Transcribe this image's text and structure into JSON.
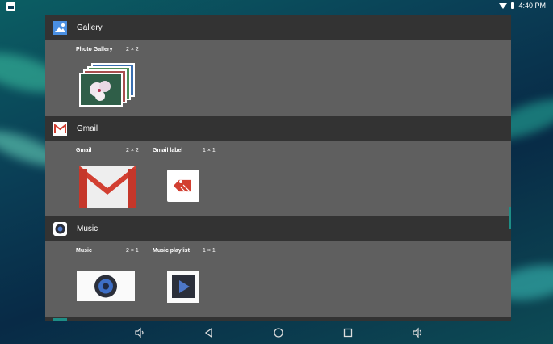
{
  "status_bar": {
    "time": "4:40 PM"
  },
  "sections": [
    {
      "title": "Gallery",
      "icon": "gallery-app-icon",
      "widgets": [
        {
          "name": "Photo Gallery",
          "size": "2 × 2"
        }
      ]
    },
    {
      "title": "Gmail",
      "icon": "gmail-app-icon",
      "widgets": [
        {
          "name": "Gmail",
          "size": "2 × 2"
        },
        {
          "name": "Gmail label",
          "size": "1 × 1"
        }
      ]
    },
    {
      "title": "Music",
      "icon": "music-app-icon",
      "widgets": [
        {
          "name": "Music",
          "size": "2 × 1"
        },
        {
          "name": "Music playlist",
          "size": "1 × 1"
        }
      ]
    }
  ],
  "colors": {
    "accent": "#1e8e86",
    "header_bg": "#333333",
    "panel_bg": "#5f5f5f",
    "gmail_red": "#d23f31"
  }
}
